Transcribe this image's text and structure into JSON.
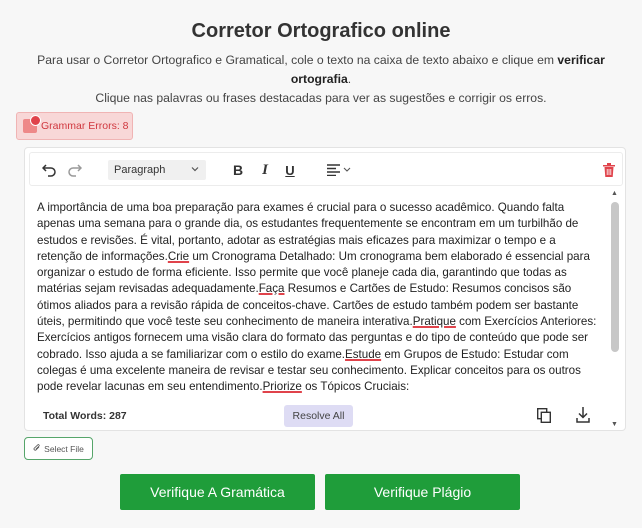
{
  "header": {
    "title": "Corretor Ortografico online",
    "desc_line1_pre": "Para usar o Corretor Ortografico e Gramatical, cole o texto na caixa de texto abaixo e clique em ",
    "desc_line1_bold": "verificar ortografia",
    "desc_line1_post": ".",
    "desc_line2": "Clique nas palavras ou frases destacadas para ver as sugestões e corrigir os erros."
  },
  "grammar_badge": {
    "label": "Grammar Errors: 8"
  },
  "toolbar": {
    "paragraph_value": "Paragraph",
    "bold_label": "B",
    "italic_label": "I",
    "underline_label": "U",
    "icons": [
      "undo-icon",
      "redo-icon",
      "chevron-down-icon",
      "align-left-icon",
      "trash-icon"
    ]
  },
  "editor": {
    "segments": [
      {
        "t": "A importância de uma boa preparação para exames é crucial para o sucesso acadêmico. Quando falta apenas uma semana para o grande dia, os estudantes frequentemente se encontram em um turbilhão de estudos e revisões. É vital, portanto, adotar as estratégias mais eficazes para maximizar o tempo e a retenção de informações.",
        "e": false
      },
      {
        "t": "Crie",
        "e": true
      },
      {
        "t": " um Cronograma Detalhado: Um cronograma bem elaborado é essencial para organizar o estudo de forma eficiente. Isso permite que você planeje cada dia, garantindo que todas as matérias sejam revisadas adequadamente.",
        "e": false
      },
      {
        "t": "Faça",
        "e": true
      },
      {
        "t": " Resumos e Cartões de Estudo: Resumos concisos são ótimos aliados para a revisão rápida de conceitos-chave. Cartões de estudo também podem ser bastante úteis, permitindo que você teste seu conhecimento de maneira interativa.",
        "e": false
      },
      {
        "t": "Pratique",
        "e": true
      },
      {
        "t": " com Exercícios Anteriores: Exercícios antigos fornecem uma visão clara do formato das perguntas e do tipo de conteúdo que pode ser cobrado. Isso ajuda a se familiarizar com o estilo do exame.",
        "e": false
      },
      {
        "t": "Estude",
        "e": true
      },
      {
        "t": " em Grupos de Estudo: Estudar com colegas é uma excelente maneira de revisar e testar seu conhecimento. Explicar conceitos para os outros pode revelar lacunas em seu entendimento.",
        "e": false
      },
      {
        "t": "Priorize",
        "e": true
      },
      {
        "t": " os Tópicos Cruciais:",
        "e": false
      }
    ],
    "total_words": "Total Words: 287",
    "resolve_all": "Resolve All"
  },
  "select_file": {
    "label": "Select File"
  },
  "buttons": {
    "grammar": "Verifique A Gramática",
    "plagio": "Verifique Plágio"
  },
  "colors": {
    "accent_green": "#1f9d3a",
    "error_red": "#e0434b",
    "badge_bg": "#f8d7d7",
    "resolve_bg": "#dedcf4"
  }
}
